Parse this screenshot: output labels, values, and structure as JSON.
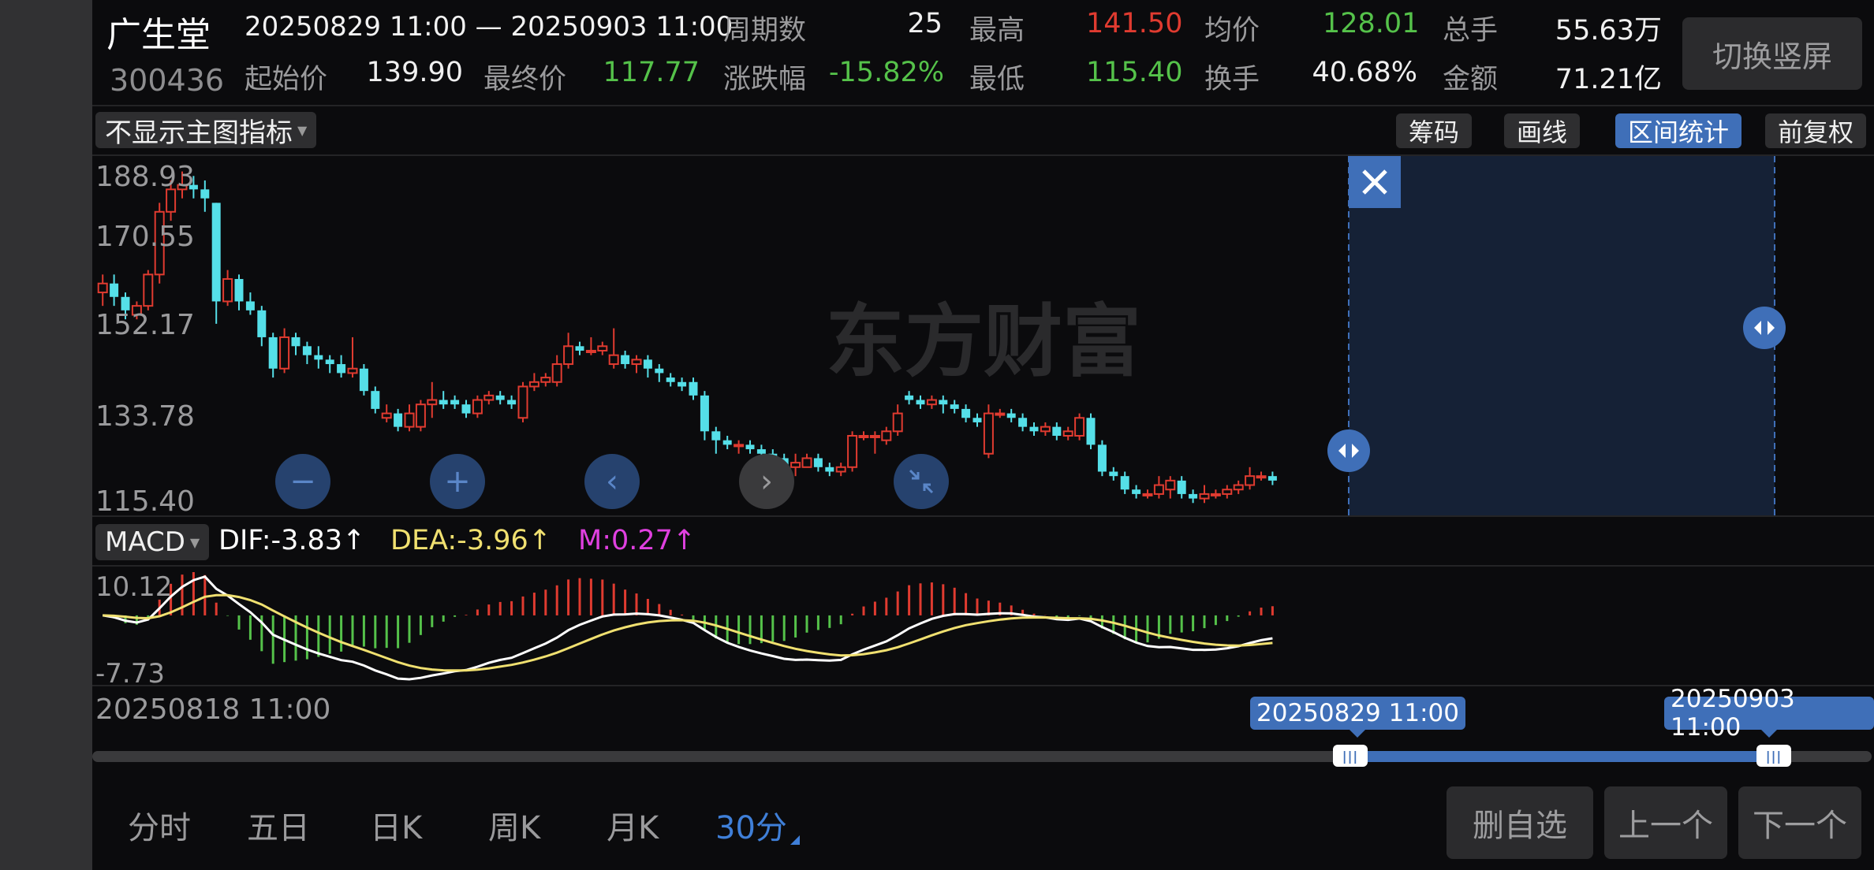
{
  "header": {
    "stock_name": "广生堂",
    "stock_code": "300436",
    "range_text": "20250829 11:00 — 20250903 11:00",
    "stats": {
      "period_count_label": "周期数",
      "period_count": "25",
      "high_label": "最高",
      "high": "141.50",
      "avg_label": "均价",
      "avg": "128.01",
      "volume_label": "总手",
      "volume": "55.63万",
      "start_label": "起始价",
      "start": "139.90",
      "end_label": "最终价",
      "end": "117.77",
      "change_label": "涨跌幅",
      "change": "-15.82%",
      "low_label": "最低",
      "low": "115.40",
      "turnover_label": "换手",
      "turnover": "40.68%",
      "amount_label": "金额",
      "amount": "71.21亿"
    },
    "switch_button": "切换竖屏"
  },
  "main_toolbar": {
    "indicator_select": "不显示主图指标",
    "buttons": [
      "筹码",
      "画线",
      "区间统计",
      "前复权"
    ],
    "active_button": "区间统计"
  },
  "price_axis": [
    "188.93",
    "170.55",
    "152.17",
    "133.78",
    "115.40"
  ],
  "watermark": "东方财富",
  "zoom_controls": [
    "zoom-out",
    "zoom-in",
    "prev",
    "next",
    "collapse"
  ],
  "macd": {
    "select": "MACD",
    "dif": "DIF:-3.83↑",
    "dea": "DEA:-3.96↑",
    "m": "M:0.27↑",
    "axis_top": "10.12",
    "axis_bottom": "-7.73"
  },
  "time_axis": {
    "start": "20250818 11:00",
    "range_start": "20250829 11:00",
    "range_end": "20250903 11:00",
    "partial": "2"
  },
  "tabs": [
    "分时",
    "五日",
    "日K",
    "周K",
    "月K",
    "30分"
  ],
  "active_tab": "30分",
  "bottom_buttons": [
    "删自选",
    "上一个",
    "下一个"
  ],
  "colors": {
    "up": "#e03b30",
    "down": "#55dfe8",
    "accent": "#3f6fb8",
    "dif": "#ffffff",
    "dea": "#f0e070",
    "m": "#e040e0"
  },
  "chart_data": {
    "type": "candlestick",
    "ylim": [
      115.4,
      188.93
    ],
    "candles": [
      [
        162,
        164,
        166,
        159
      ],
      [
        164,
        161,
        166,
        159
      ],
      [
        161,
        158,
        162,
        156
      ],
      [
        157,
        159,
        160,
        156
      ],
      [
        159,
        166,
        167,
        158
      ],
      [
        166,
        180,
        182,
        164
      ],
      [
        180,
        185,
        187,
        178
      ],
      [
        185,
        186,
        189,
        183
      ],
      [
        186,
        185,
        188,
        183
      ],
      [
        185,
        183,
        187,
        180
      ],
      [
        182,
        160,
        182,
        155
      ],
      [
        160,
        165,
        167,
        159
      ],
      [
        165,
        160,
        166,
        158
      ],
      [
        160,
        158,
        162,
        157
      ],
      [
        158,
        152,
        159,
        150
      ],
      [
        152,
        145,
        153,
        143
      ],
      [
        145,
        152,
        154,
        144
      ],
      [
        152,
        150,
        153,
        148
      ],
      [
        150,
        148,
        151,
        146
      ],
      [
        148,
        147,
        150,
        145
      ],
      [
        147,
        146,
        148,
        144
      ],
      [
        146,
        144,
        148,
        143
      ],
      [
        144,
        145,
        152,
        143
      ],
      [
        145,
        140,
        146,
        139
      ],
      [
        140,
        136,
        141,
        135
      ],
      [
        134,
        135,
        137,
        133
      ],
      [
        135,
        132,
        136,
        131
      ],
      [
        132,
        135,
        137,
        131
      ],
      [
        132,
        137,
        138,
        131
      ],
      [
        137,
        138,
        142,
        134
      ],
      [
        138,
        137,
        140,
        136
      ],
      [
        138,
        137,
        139,
        136
      ],
      [
        137,
        135,
        138,
        134
      ],
      [
        135,
        138,
        139,
        134
      ],
      [
        138,
        139,
        140,
        137
      ],
      [
        139,
        138,
        140,
        137
      ],
      [
        138,
        137,
        139,
        136
      ],
      [
        134,
        141,
        142,
        133
      ],
      [
        141,
        142,
        144,
        140
      ],
      [
        142,
        143,
        144,
        141
      ],
      [
        142,
        146,
        148,
        141
      ],
      [
        146,
        150,
        153,
        145
      ],
      [
        150,
        149,
        151,
        148
      ],
      [
        149,
        149,
        152,
        148
      ],
      [
        149,
        150,
        151,
        148
      ],
      [
        146,
        148,
        154,
        145
      ],
      [
        148,
        146,
        149,
        145
      ],
      [
        146,
        147,
        148,
        144
      ],
      [
        147,
        145,
        148,
        143
      ],
      [
        145,
        144,
        146,
        142
      ],
      [
        143,
        142,
        144,
        141
      ],
      [
        142,
        141,
        143,
        140
      ],
      [
        142,
        139,
        143,
        138
      ],
      [
        139,
        131,
        140,
        129
      ],
      [
        131,
        129,
        132,
        126
      ],
      [
        129,
        128,
        130,
        127
      ],
      [
        128,
        128,
        129,
        126
      ],
      [
        128,
        127,
        129,
        126
      ],
      [
        127,
        126,
        128,
        125
      ],
      [
        126,
        125,
        127,
        124
      ],
      [
        125,
        123,
        126,
        122
      ],
      [
        123,
        124,
        126,
        121
      ],
      [
        123,
        125,
        126,
        123
      ],
      [
        125,
        123,
        126,
        122
      ],
      [
        123,
        122,
        124,
        121
      ],
      [
        122,
        123,
        124,
        121
      ],
      [
        123,
        130,
        131,
        122
      ],
      [
        130,
        130,
        131,
        129
      ],
      [
        130,
        130,
        131,
        126
      ],
      [
        129,
        131,
        132,
        128
      ],
      [
        131,
        135,
        137,
        130
      ],
      [
        139,
        138,
        140,
        137
      ],
      [
        138,
        137,
        139,
        136
      ],
      [
        137,
        138,
        139,
        136
      ],
      [
        138,
        137,
        139,
        135
      ],
      [
        137,
        136,
        138,
        135
      ],
      [
        136,
        134,
        137,
        133
      ],
      [
        134,
        133,
        135,
        132
      ],
      [
        126,
        135,
        137,
        125
      ],
      [
        135,
        135,
        136,
        134
      ],
      [
        135,
        134,
        136,
        133
      ],
      [
        134,
        132,
        135,
        131
      ],
      [
        132,
        131,
        133,
        130
      ],
      [
        131,
        132,
        133,
        130
      ],
      [
        132,
        130,
        133,
        129
      ],
      [
        130,
        131,
        132,
        129
      ],
      [
        130,
        134,
        135,
        129
      ],
      [
        134,
        128,
        135,
        127
      ],
      [
        128,
        122,
        129,
        121
      ],
      [
        122,
        121,
        123,
        120
      ],
      [
        121,
        118,
        122,
        117
      ],
      [
        118,
        117,
        119,
        116
      ],
      [
        117,
        117,
        118,
        116
      ],
      [
        117,
        119,
        121,
        116
      ],
      [
        118,
        120,
        121,
        116
      ],
      [
        120,
        117,
        121,
        116
      ],
      [
        117,
        116,
        118,
        115
      ],
      [
        116,
        117,
        119,
        115
      ],
      [
        117,
        117,
        118,
        116
      ],
      [
        117,
        118,
        119,
        116
      ],
      [
        118,
        119,
        120,
        117
      ],
      [
        119,
        121,
        123,
        118
      ],
      [
        121,
        121,
        122,
        120
      ],
      [
        121,
        120,
        122,
        119
      ]
    ]
  }
}
